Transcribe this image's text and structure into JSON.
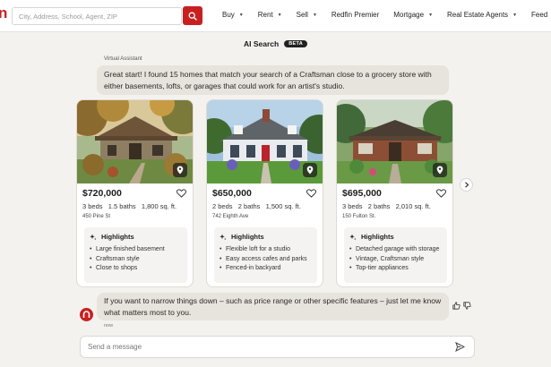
{
  "brand": {
    "accent": "#c82021",
    "logo_letter": "n",
    "logo_sub": "REDFIN"
  },
  "search": {
    "placeholder": "City, Address, School, Agent, ZIP",
    "value": ""
  },
  "nav": {
    "items": [
      {
        "label": "Buy",
        "dropdown": true
      },
      {
        "label": "Rent",
        "dropdown": true
      },
      {
        "label": "Sell",
        "dropdown": true
      },
      {
        "label": "Redfin Premier",
        "dropdown": false
      },
      {
        "label": "Mortgage",
        "dropdown": true
      },
      {
        "label": "Real Estate Agents",
        "dropdown": true
      },
      {
        "label": "Feed",
        "dropdown": false
      }
    ]
  },
  "header": {
    "title": "AI Search",
    "badge": "BETA"
  },
  "chat": {
    "assistant_label": "Virtual Assistant",
    "message_1": "Great start! I found 15 homes that match your search of a Craftsman close to a grocery store with either basements, lofts, or garages that could work for an artist's studio.",
    "message_2": "If you want to narrow things down – such as price range or other specific features – just let me know what matters most to you.",
    "timestamp": "now",
    "input_placeholder": "Send a message"
  },
  "listings": [
    {
      "price": "$720,000",
      "facts": "3 beds   1.5 baths   1,800 sq. ft.",
      "address": "450 Pine St",
      "highlights_title": "Highlights",
      "highlights": [
        "Large finished basement",
        "Craftsman style",
        "Close to shops"
      ],
      "image_icon": "craftsman-house-photo"
    },
    {
      "price": "$650,000",
      "facts": "2 beds   2 baths   1,500 sq. ft.",
      "address": "742 Eighth Ave",
      "highlights_title": "Highlights",
      "highlights": [
        "Flexible loft for a studio",
        "Easy access cafes and parks",
        "Fenced-in backyard"
      ],
      "image_icon": "cape-cod-house-photo"
    },
    {
      "price": "$695,000",
      "facts": "3 beds   2 baths   2,010 sq. ft.",
      "address": "150 Fulton St.",
      "highlights_title": "Highlights",
      "highlights": [
        "Detached garage with storage",
        "Vintage, Craftsman style",
        "Top-tier appliances"
      ],
      "image_icon": "brick-craftsman-house-photo"
    }
  ],
  "icons": {
    "search": "search-icon",
    "map_pin": "map-pin-icon",
    "favorite": "heart-icon",
    "highlights": "sparkle-icon",
    "next": "chevron-right-icon",
    "thumbs_up": "thumbs-up-icon",
    "thumbs_down": "thumbs-down-icon",
    "send": "send-icon",
    "avatar": "redfin-avatar-icon"
  }
}
